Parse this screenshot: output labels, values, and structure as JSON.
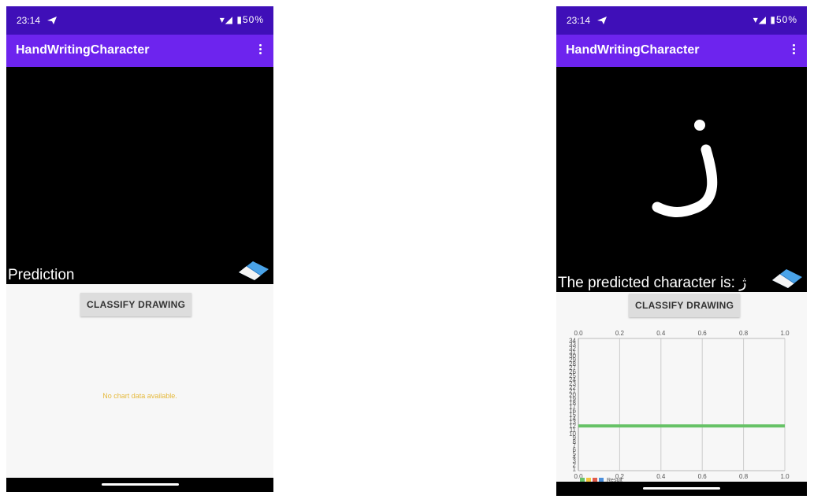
{
  "screens": [
    {
      "status_time": "23:14",
      "status_icons": "▾◢ ▮50%",
      "app_title": "HandWritingCharacter",
      "prediction_text": "Prediction",
      "classify_label": "CLASSIFY DRAWING",
      "chart_empty_text": "No chart data available."
    },
    {
      "status_time": "23:14",
      "status_icons": "▾◢ ▮50%",
      "app_title": "HandWritingCharacter",
      "prediction_text": "The predicted character is: ژ",
      "classify_label": "CLASSIFY DRAWING"
    }
  ],
  "icons": [
    "telegram-icon",
    "wifi-icon",
    "signal-icon",
    "battery-icon",
    "overflow-menu-icon",
    "eraser-icon"
  ],
  "colors": {
    "status_bar": "#3f0fb8",
    "app_bar": "#6d24ee",
    "bar": "#66c266",
    "empty_text": "#e5b93c"
  },
  "chart_data": {
    "type": "bar",
    "orientation": "horizontal",
    "categories": [
      "1",
      "2",
      "3",
      "4",
      "5",
      "6",
      "7",
      "8",
      "9",
      "10",
      "11",
      "12",
      "13",
      "14",
      "15",
      "16",
      "17",
      "18",
      "19",
      "20",
      "21",
      "22",
      "23",
      "24",
      "25",
      "26",
      "27",
      "28",
      "29",
      "30",
      "31",
      "32",
      "33",
      "34"
    ],
    "values": [
      0,
      0,
      0,
      0,
      0,
      0,
      0,
      0,
      0,
      0,
      0,
      1.0,
      0,
      0,
      0,
      0,
      0,
      0,
      0,
      0,
      0,
      0,
      0,
      0,
      0,
      0,
      0,
      0,
      0,
      0,
      0,
      0,
      0,
      0
    ],
    "xlim": [
      0,
      1.0
    ],
    "x_ticks": [
      "0.0",
      "0.2",
      "0.4",
      "0.6",
      "0.8",
      "1.0"
    ],
    "y_ticks_visible": [
      "34",
      "12",
      "11",
      "2",
      "1"
    ],
    "legend": {
      "entries": [
        "Result"
      ],
      "swatch_colors": [
        "#66c266",
        "#f2c43d",
        "#e05a4a",
        "#4b8fdc"
      ],
      "placement": "bottom-left"
    },
    "grid": true
  }
}
